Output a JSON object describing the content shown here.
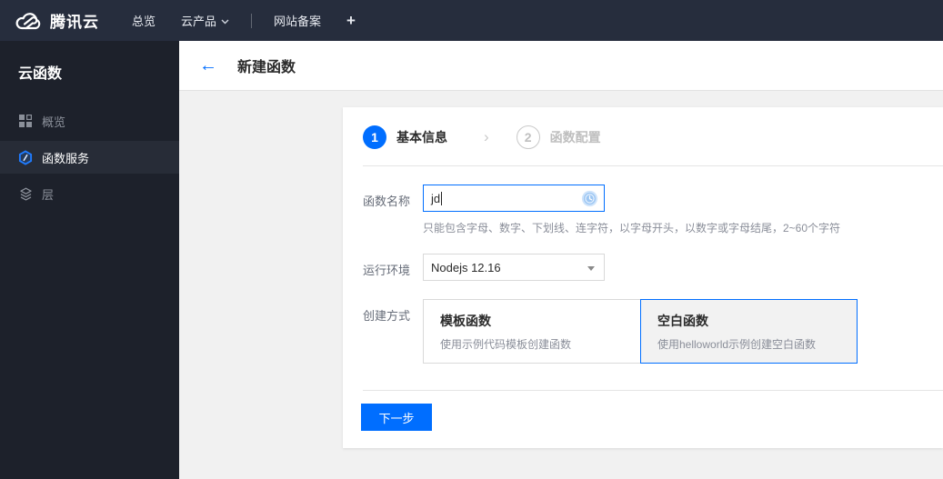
{
  "colors": {
    "accent": "#006eff",
    "topbar_bg": "#262d3d",
    "sidebar_bg": "#1d212b",
    "content_bg": "#f1f1f1"
  },
  "topbar": {
    "brand": "腾讯云",
    "items": [
      {
        "label": "总览"
      },
      {
        "label": "云产品"
      },
      {
        "label": "网站备案"
      },
      {
        "label": "+"
      }
    ]
  },
  "sidebar": {
    "title": "云函数",
    "items": [
      {
        "label": "概览",
        "icon": "grid-icon",
        "selected": false
      },
      {
        "label": "函数服务",
        "icon": "scf-hexagon-icon",
        "selected": true
      },
      {
        "label": "层",
        "icon": "layers-icon",
        "selected": false
      }
    ]
  },
  "header": {
    "back": "←",
    "title": "新建函数"
  },
  "wizard": {
    "separator": "›",
    "steps": [
      {
        "number": "1",
        "label": "基本信息",
        "active": true
      },
      {
        "number": "2",
        "label": "函数配置",
        "active": false
      }
    ]
  },
  "form": {
    "name": {
      "label": "函数名称",
      "value": "jd",
      "status_icon": "clock-icon",
      "help": "只能包含字母、数字、下划线、连字符，以字母开头，以数字或字母结尾，2~60个字符"
    },
    "runtime": {
      "label": "运行环境",
      "value": "Nodejs 12.16"
    },
    "method": {
      "label": "创建方式",
      "options": [
        {
          "title": "模板函数",
          "desc": "使用示例代码模板创建函数",
          "selected": false
        },
        {
          "title": "空白函数",
          "desc": "使用helloworld示例创建空白函数",
          "selected": true
        }
      ]
    }
  },
  "actions": {
    "next": "下一步"
  }
}
